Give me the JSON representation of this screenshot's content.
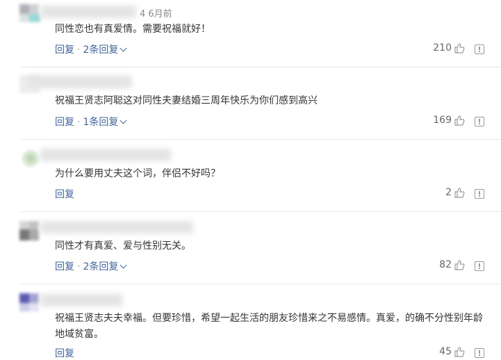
{
  "comments": [
    {
      "time": "4 6月前",
      "text": "同性恋也有真爱情。需要祝福就好！",
      "reply_label": "回复",
      "sub_replies_label": "2条回复",
      "likes": "210"
    },
    {
      "text": "祝福王贤志阿聪这对同性夫妻结婚三周年快乐为你们感到高兴",
      "reply_label": "回复",
      "sub_replies_label": "1条回复",
      "likes": "169"
    },
    {
      "text": "为什么要用丈夫这个词，伴侣不好吗？",
      "reply_label": "回复",
      "likes": "2"
    },
    {
      "text": "同性才有真爱、爱与性别无关。",
      "reply_label": "回复",
      "sub_replies_label": "2条回复",
      "likes": "82"
    },
    {
      "text": "祝福王贤志夫夫幸福。但要珍惜，希望一起生活的朋友珍惜来之不易感情。真爱，的确不分性别年龄地域贫富。",
      "reply_label": "回复",
      "likes": "45"
    }
  ]
}
